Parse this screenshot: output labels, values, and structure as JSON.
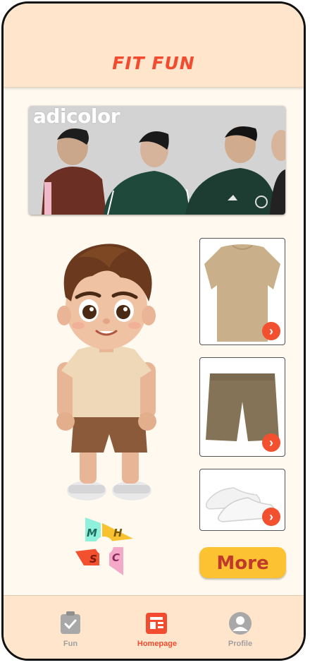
{
  "app": {
    "title": "FIT FUN"
  },
  "banner": {
    "brand_text": "adicolor"
  },
  "items": [
    {
      "name": "t-shirt",
      "icon": "chevron-right-icon"
    },
    {
      "name": "shorts",
      "icon": "chevron-right-icon"
    },
    {
      "name": "sneakers",
      "icon": "chevron-right-icon"
    }
  ],
  "size_selector": {
    "letters": [
      "M",
      "H",
      "S",
      "C"
    ]
  },
  "more_button": {
    "label": "More"
  },
  "nav": {
    "tabs": [
      {
        "label": "Fun",
        "icon": "checklist-icon",
        "active": false
      },
      {
        "label": "Homepage",
        "icon": "document-icon",
        "active": true
      },
      {
        "label": "Profile",
        "icon": "profile-icon",
        "active": false
      }
    ]
  },
  "colors": {
    "accent": "#f24b2f",
    "header_bg": "#ffe5cc",
    "button": "#fcc232",
    "active_tab": "#f24b2f",
    "inactive_tab": "#9a9a9a"
  }
}
